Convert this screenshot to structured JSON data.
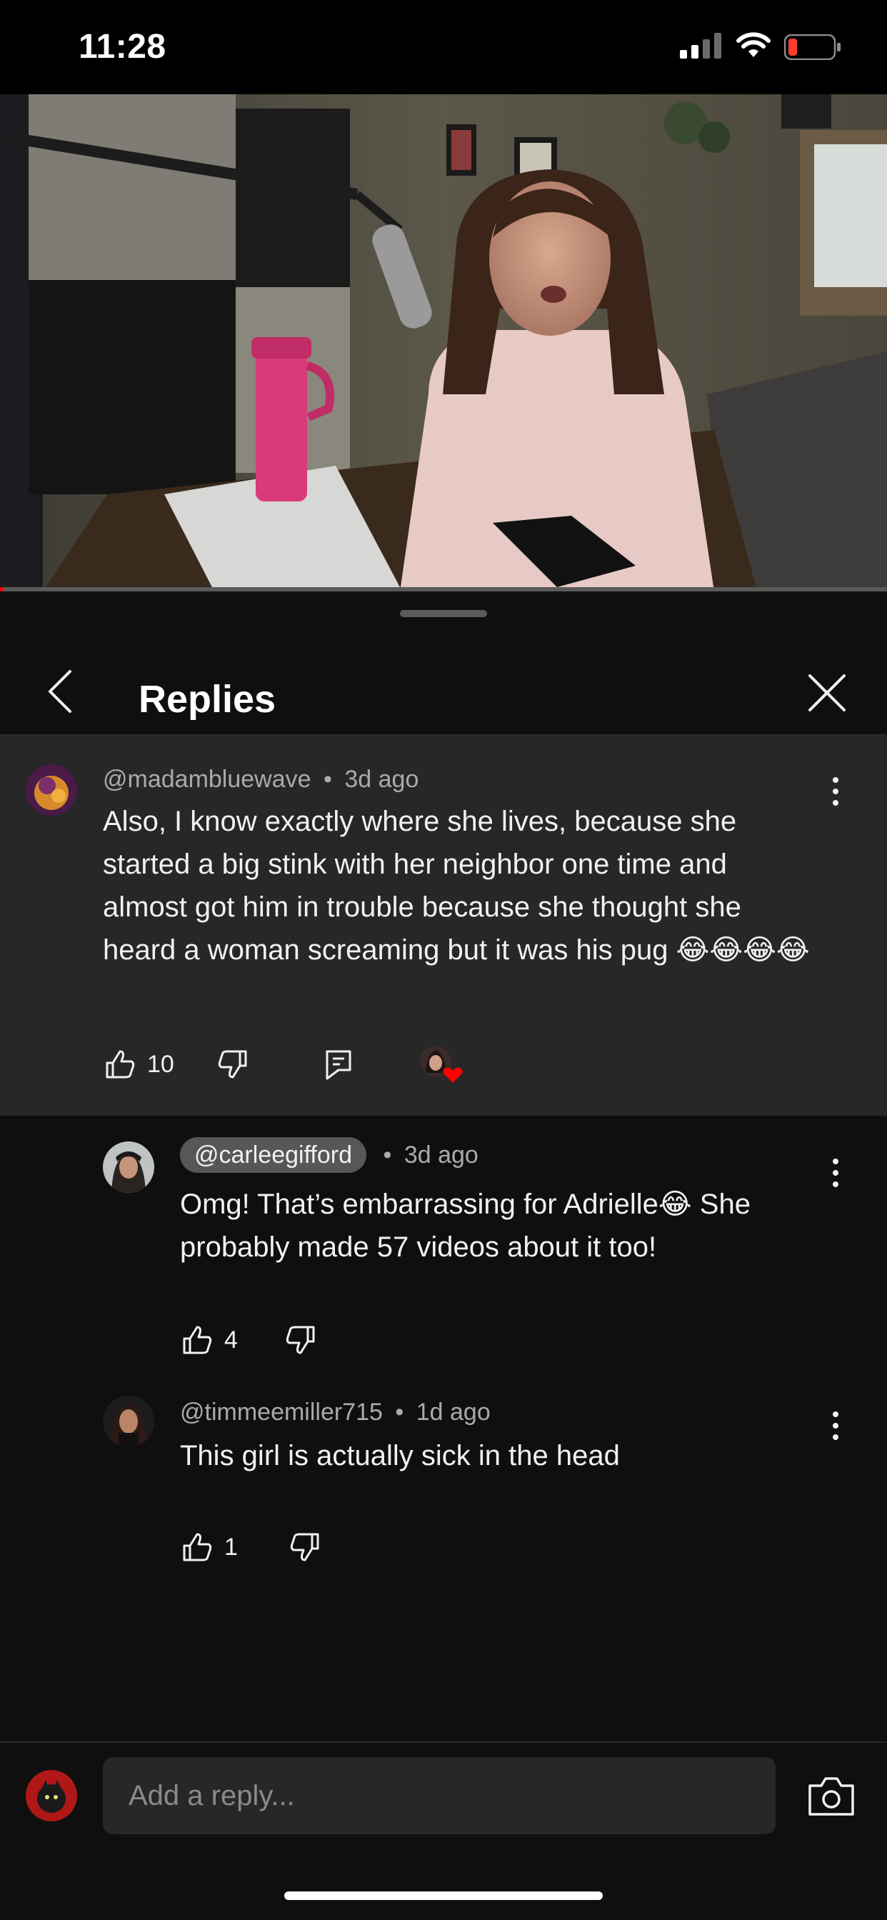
{
  "status_bar": {
    "time": "11:28",
    "icons": [
      "cellular-signal-icon",
      "wifi-icon",
      "battery-low-icon"
    ],
    "battery_color": "#ff3b30"
  },
  "video": {
    "progress_fraction": 0.003,
    "progress_color": "#ff0000"
  },
  "sheet": {
    "title": "Replies",
    "back_icon": "chevron-left-icon",
    "close_icon": "close-icon"
  },
  "parent_comment": {
    "handle": "@madambluewave",
    "separator": "•",
    "age": "3d ago",
    "text": "Also, I know exactly where she lives, because she started a big stink with her neighbor one time and almost got him in trouble because she thought she heard a woman screaming but it was his pug 😂😂😂😂",
    "likes": "10",
    "icons": [
      "thumbs-up-icon",
      "thumbs-down-icon",
      "reply-icon",
      "creator-heart-icon"
    ]
  },
  "replies": [
    {
      "handle": "@carleegifford",
      "separator": "•",
      "age": "3d ago",
      "text": "Omg! That’s embarrassing for Adrielle😂 She probably made 57 videos about it too!",
      "likes": "4"
    },
    {
      "handle": "@timmeemiller715",
      "separator": "•",
      "age": "1d ago",
      "text": "This girl is actually sick in the head",
      "likes": "1"
    }
  ],
  "reply_input": {
    "placeholder": "Add a reply...",
    "camera_icon": "camera-icon"
  },
  "colors": {
    "background": "#0f0f0f",
    "highlight_card": "#272727",
    "secondary_text": "#aaaaaa"
  }
}
